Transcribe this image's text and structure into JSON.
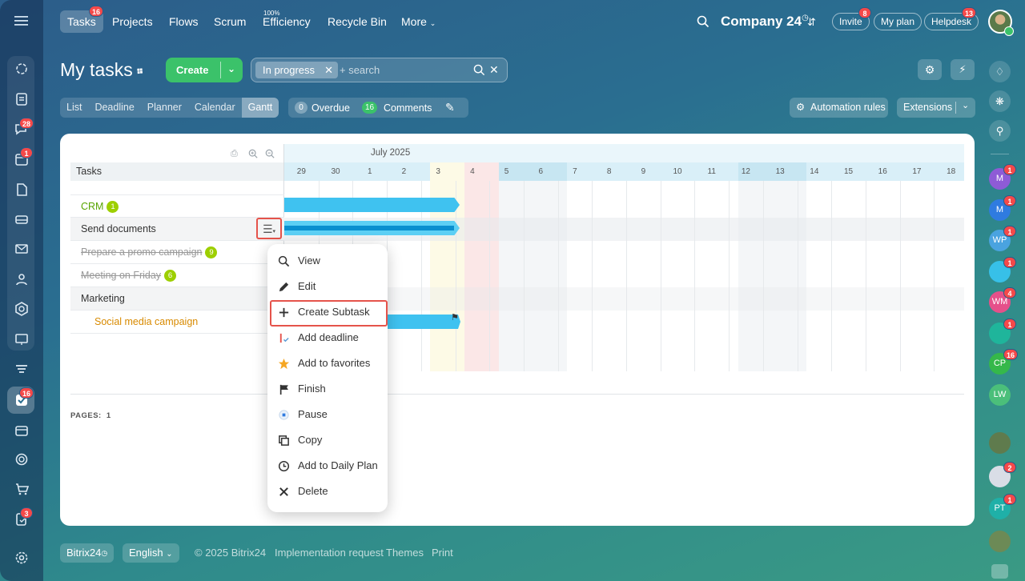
{
  "nav": {
    "tabs": [
      {
        "label": "Tasks",
        "badge": "16"
      },
      {
        "label": "Projects"
      },
      {
        "label": "Flows"
      },
      {
        "label": "Scrum"
      },
      {
        "label": "Efficiency",
        "super": "100%"
      },
      {
        "label": "Recycle Bin"
      },
      {
        "label": "More"
      }
    ],
    "company": "Company 24",
    "invite": "Invite",
    "invite_badge": "8",
    "my_plan": "My plan",
    "helpdesk": "Helpdesk",
    "helpdesk_badge": "13"
  },
  "left_sidebar": {
    "badges": {
      "chat": "28",
      "calendar": "1",
      "tasks": "16",
      "forms": "3"
    }
  },
  "page": {
    "title": "My tasks",
    "create_label": "Create",
    "filter_chip": "In progress",
    "search_placeholder": "+ search",
    "views": [
      "List",
      "Deadline",
      "Planner",
      "Calendar",
      "Gantt"
    ],
    "overdue_count": "0",
    "overdue_label": "Overdue",
    "comments_count": "16",
    "comments_label": "Comments",
    "automation_label": "Automation rules",
    "extensions_label": "Extensions"
  },
  "gantt": {
    "tasks_header": "Tasks",
    "month": "July 2025",
    "days": [
      "29",
      "30",
      "1",
      "2",
      "3",
      "4",
      "5",
      "6",
      "7",
      "8",
      "9",
      "10",
      "11",
      "12",
      "13",
      "14",
      "15",
      "16",
      "17",
      "18"
    ],
    "rows": [
      {
        "name": "CRM",
        "count": "1"
      },
      {
        "name": "Send documents"
      },
      {
        "name": "Prepare a promo campaign",
        "count": "9"
      },
      {
        "name": "Meeting on Friday",
        "count": "6"
      },
      {
        "name": "Marketing"
      },
      {
        "name": "Social media campaign"
      }
    ],
    "pages_label": "PAGES:",
    "pages_value": "1"
  },
  "context_menu": {
    "items": [
      "View",
      "Edit",
      "Create Subtask",
      "Add deadline",
      "Add to favorites",
      "Finish",
      "Pause",
      "Copy",
      "Add to Daily Plan",
      "Delete"
    ]
  },
  "right_sidebar": {
    "avatars": [
      {
        "initials": "M",
        "badge": "1",
        "color": "#8e5bd6"
      },
      {
        "initials": "M",
        "badge": "1",
        "color": "#2f7be0"
      },
      {
        "initials": "WP",
        "badge": "1",
        "color": "#4aa3e0"
      },
      {
        "initials": "",
        "badge": "1",
        "color": "#37c0e8"
      },
      {
        "initials": "WM",
        "badge": "4",
        "color": "#e5508a"
      },
      {
        "initials": "",
        "badge": "1",
        "color": "#1fb59b"
      },
      {
        "initials": "CP",
        "badge": "16",
        "color": "#35b84a"
      },
      {
        "initials": "LW",
        "badge": "",
        "color": "#4bbf7a"
      }
    ],
    "extra_badges": [
      "2",
      "1"
    ],
    "pt_initials": "PT"
  },
  "footer": {
    "brand": "Bitrix24",
    "language": "English",
    "copyright": "© 2025 Bitrix24",
    "implementation": "Implementation request",
    "themes": "Themes",
    "print": "Print"
  }
}
